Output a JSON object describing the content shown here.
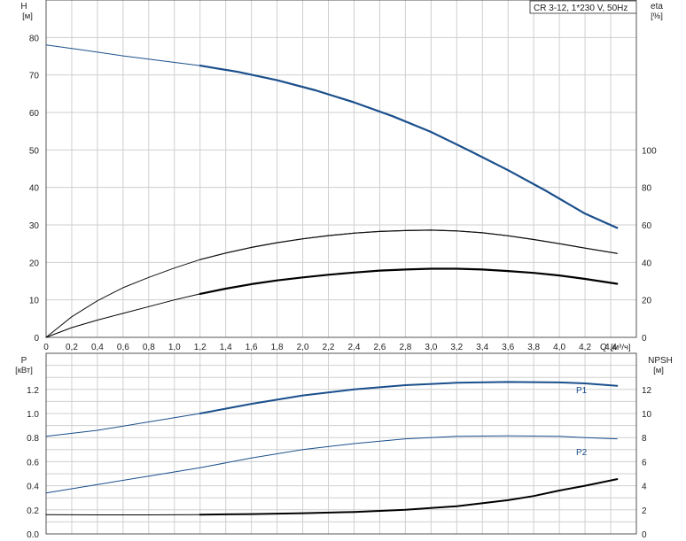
{
  "chart_data": {
    "title": "CR 3-12, 1*230 V, 50Hz",
    "type": "line",
    "x_axis": {
      "name": "Q",
      "unit": "[м³/ч]",
      "range": [
        0,
        4.6
      ],
      "ticks": [
        0,
        0.2,
        0.4,
        0.6,
        0.8,
        1.0,
        1.2,
        1.4,
        1.6,
        1.8,
        2.0,
        2.2,
        2.4,
        2.6,
        2.8,
        3.0,
        3.2,
        3.4,
        3.6,
        3.8,
        4.0,
        4.2,
        4.4
      ],
      "tick_labels": [
        "0",
        "0,2",
        "0,4",
        "0,6",
        "0,8",
        "1,0",
        "1,2",
        "1,4",
        "1,6",
        "1,8",
        "2,0",
        "2,2",
        "2,4",
        "2,6",
        "2,8",
        "3,0",
        "3,2",
        "3,4",
        "3,6",
        "3,8",
        "4,0",
        "4,2",
        "4,4"
      ]
    },
    "top_panel": {
      "left_axis": {
        "name": "H",
        "unit": "[м]",
        "range": [
          0,
          90
        ],
        "ticks": [
          0,
          10,
          20,
          30,
          40,
          50,
          60,
          70,
          80
        ]
      },
      "right_axis": {
        "name": "eta",
        "unit": "[%]",
        "range": [
          0,
          180
        ],
        "ticks": [
          0,
          20,
          40,
          60,
          80,
          100
        ]
      },
      "series": [
        {
          "axis": "left",
          "color": "#1a4f8c",
          "width": 2.2,
          "x": [
            0,
            0.3,
            0.6,
            0.9,
            1.2,
            1.5,
            1.8,
            2.1,
            2.4,
            2.7,
            3.0,
            3.3,
            3.6,
            3.9,
            4.2,
            4.45
          ],
          "y": [
            78,
            76.6,
            75.1,
            73.8,
            72.5,
            70.8,
            68.6,
            65.9,
            62.7,
            59.0,
            54.8,
            49.8,
            44.6,
            39.0,
            33.0,
            29.2
          ],
          "duty_from": 1.2
        },
        {
          "axis": "right",
          "color": "#111111",
          "width": 1.2,
          "x": [
            0,
            0.2,
            0.4,
            0.6,
            0.8,
            1.0,
            1.2,
            1.4,
            1.6,
            1.8,
            2.0,
            2.2,
            2.4,
            2.6,
            2.8,
            3.0,
            3.2,
            3.4,
            3.6,
            3.8,
            4.0,
            4.2,
            4.45
          ],
          "y": [
            0,
            11,
            19.5,
            26.5,
            32,
            37,
            41.5,
            45,
            48,
            50.5,
            52.6,
            54.3,
            55.6,
            56.5,
            57,
            57.2,
            56.8,
            55.8,
            54.2,
            52.2,
            50,
            47.6,
            44.8
          ],
          "duty_from": 1.2
        },
        {
          "axis": "left",
          "color": "#000000",
          "width": 2.2,
          "x": [
            0,
            0.2,
            0.4,
            0.6,
            0.8,
            1.0,
            1.2,
            1.4,
            1.6,
            1.8,
            2.0,
            2.2,
            2.4,
            2.6,
            2.8,
            3.0,
            3.2,
            3.4,
            3.6,
            3.8,
            4.0,
            4.2,
            4.45
          ],
          "y": [
            0,
            2.6,
            4.6,
            6.4,
            8.2,
            10,
            11.6,
            13,
            14.2,
            15.2,
            16,
            16.7,
            17.3,
            17.8,
            18.1,
            18.3,
            18.3,
            18.1,
            17.7,
            17.2,
            16.5,
            15.6,
            14.3
          ],
          "duty_from": 1.2
        }
      ]
    },
    "bottom_panel": {
      "left_axis": {
        "name": "P",
        "unit": "[кВт]",
        "range": [
          0,
          1.5
        ],
        "ticks": [
          0,
          0.2,
          0.4,
          0.6,
          0.8,
          1.0,
          1.2
        ],
        "tick_labels": [
          "0.0",
          "0.2",
          "0.4",
          "0.6",
          "0.8",
          "1.0",
          "1.2"
        ]
      },
      "right_axis": {
        "name": "NPSH",
        "unit": "[м]",
        "range": [
          0,
          15
        ],
        "ticks": [
          0,
          2,
          4,
          6,
          8,
          10,
          12
        ]
      },
      "series": [
        {
          "name": "P1",
          "axis": "left",
          "color": "#1a4f8c",
          "width": 2.0,
          "x": [
            0,
            0.4,
            0.8,
            1.2,
            1.6,
            2.0,
            2.4,
            2.8,
            3.2,
            3.6,
            4.0,
            4.2,
            4.45
          ],
          "y": [
            0.81,
            0.86,
            0.93,
            1.0,
            1.08,
            1.15,
            1.2,
            1.235,
            1.255,
            1.262,
            1.258,
            1.25,
            1.23
          ],
          "duty_from": 1.2
        },
        {
          "name": "P2",
          "axis": "left",
          "color": "#1a4f8c",
          "width": 1.2,
          "x": [
            0,
            0.4,
            0.8,
            1.2,
            1.6,
            2.0,
            2.4,
            2.8,
            3.2,
            3.6,
            4.0,
            4.2,
            4.45
          ],
          "y": [
            0.34,
            0.41,
            0.48,
            0.55,
            0.63,
            0.7,
            0.75,
            0.79,
            0.81,
            0.815,
            0.81,
            0.8,
            0.79
          ],
          "duty_from": 99
        },
        {
          "axis": "right",
          "color": "#000000",
          "width": 2.0,
          "x": [
            0,
            0.4,
            0.8,
            1.2,
            1.6,
            2.0,
            2.4,
            2.8,
            3.2,
            3.6,
            3.8,
            4.0,
            4.2,
            4.45
          ],
          "y": [
            1.6,
            1.58,
            1.58,
            1.6,
            1.65,
            1.72,
            1.82,
            2.0,
            2.3,
            2.8,
            3.15,
            3.6,
            4.0,
            4.55
          ],
          "duty_from": 1.2
        }
      ]
    }
  }
}
